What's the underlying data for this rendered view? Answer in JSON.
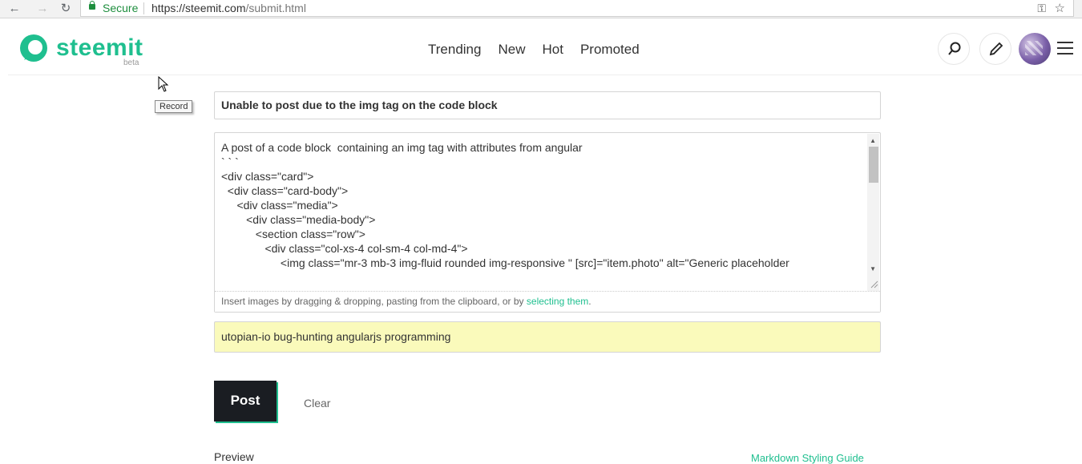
{
  "browser": {
    "secure_label": "Secure",
    "url_host": "https://steemit.com",
    "url_path": "/submit.html"
  },
  "header": {
    "logo_text": "steemit",
    "beta_label": "beta",
    "nav": [
      "Trending",
      "New",
      "Hot",
      "Promoted"
    ]
  },
  "tooltip": {
    "text": "Record"
  },
  "form": {
    "title_value": "Unable to post due to the img tag on the code block",
    "body_lines": [
      "A post of a code block  containing an img tag with attributes from angular",
      "",
      "` ` `",
      "",
      "<div class=\"card\">",
      "  <div class=\"card-body\">",
      "     <div class=\"media\">",
      "        <div class=\"media-body\">",
      "",
      "",
      "           <section class=\"row\">",
      "              <div class=\"col-xs-4 col-sm-4 col-md-4\">",
      "                   <img class=\"mr-3 mb-3 img-fluid rounded img-responsive \" [src]=\"item.photo\" alt=\"Generic placeholder"
    ],
    "footer_text": "Insert images by dragging & dropping, pasting from the clipboard, or by ",
    "footer_link": "selecting them",
    "footer_end": ".",
    "tags_value": "utopian-io bug-hunting angularjs programming",
    "post_label": "Post",
    "clear_label": "Clear",
    "preview_label": "Preview",
    "markdown_guide": "Markdown Styling Guide"
  }
}
